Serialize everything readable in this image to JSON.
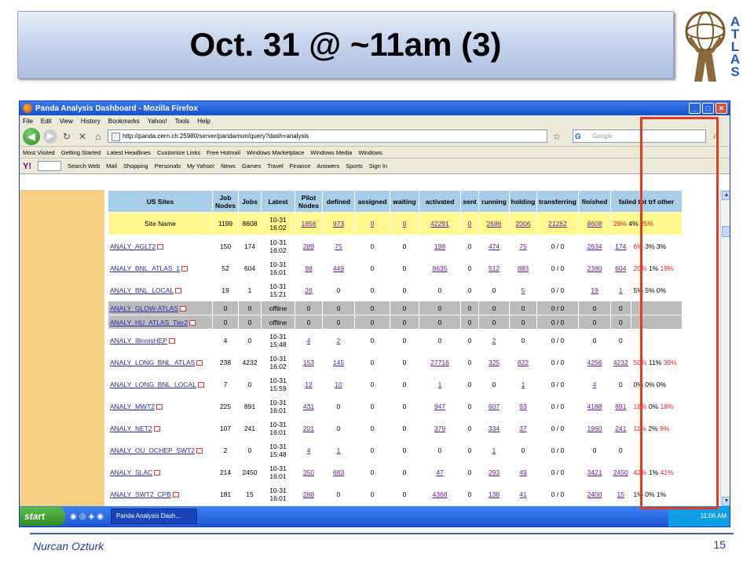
{
  "slide": {
    "title": "Oct. 31 @ ~11am (3)",
    "logo_letters": [
      "A",
      "T",
      "L",
      "A",
      "S"
    ],
    "footer_name": "Nurcan Ozturk",
    "page_number": "15"
  },
  "browser": {
    "window_title": "Panda Analysis Dashboard - Mozilla Firefox",
    "menu": [
      "File",
      "Edit",
      "View",
      "History",
      "Bookmarks",
      "Yahoo!",
      "Tools",
      "Help"
    ],
    "url": "http://panda.cern.ch:25980/server/pandamon/query?dash=analysis",
    "search_placeholder": "Google",
    "bookmarks": [
      "Most Visited",
      "Getting Started",
      "Latest Headlines",
      "Customize Links",
      "Free Hotmail",
      "Windows Marketplace",
      "Windows Media",
      "Windows"
    ],
    "yahoo_toolbar": [
      "Search Web",
      "Mail",
      "Shopping",
      "Personals",
      "My Yahoo!",
      "News",
      "Games",
      "Travel",
      "Finance",
      "Answers",
      "Sports",
      "Sign In"
    ]
  },
  "table": {
    "headers": [
      "US Sites",
      "Job Nodes",
      "Jobs",
      "Latest",
      "Pilot Nodes",
      "defined",
      "assigned",
      "waiting",
      "activated",
      "sent",
      "running",
      "holding",
      "transferring",
      "finished",
      "failed tot trf other"
    ],
    "site_row": {
      "name": "Site Name",
      "job_nodes": "1199",
      "jobs": "8608",
      "latest": "10-31 16:02",
      "pilot_nodes": "1856",
      "defined": "973",
      "assigned": "0",
      "waiting": "0",
      "activated": "42291",
      "sent": "0",
      "running": "2686",
      "holding": "2006",
      "transferring": "21262",
      "finished": "8608",
      "failed": "29%",
      "trf": "4%",
      "other": "25%"
    },
    "rows": [
      {
        "name": "ANALY_AGLT2",
        "job_nodes": "150",
        "jobs": "174",
        "latest": "10-31 16:02",
        "pilot_nodes": "289",
        "defined": "75",
        "assigned": "0",
        "waiting": "0",
        "activated": "198",
        "sent": "0",
        "running": "474",
        "holding": "75",
        "transferring": "0 / 0",
        "finished": "2634",
        "failed_tot": "174",
        "fail_pct": "6%",
        "trf_pct": "3%",
        "other_pct": "3%"
      },
      {
        "name": "ANALY_BNL_ATLAS_1",
        "job_nodes": "52",
        "jobs": "604",
        "latest": "10-31 16:01",
        "pilot_nodes": "98",
        "defined": "449",
        "assigned": "0",
        "waiting": "0",
        "activated": "8635",
        "sent": "0",
        "running": "512",
        "holding": "883",
        "transferring": "0 / 0",
        "finished": "2380",
        "failed_tot": "604",
        "fail_pct": "20%",
        "trf_pct": "1%",
        "other_pct": "19%"
      },
      {
        "name": "ANALY_BNL_LOCAL",
        "job_nodes": "19",
        "jobs": "1",
        "latest": "10-31 15:21",
        "pilot_nodes": "26",
        "defined": "0",
        "assigned": "0",
        "waiting": "0",
        "activated": "0",
        "sent": "0",
        "running": "0",
        "holding": "5",
        "transferring": "0 / 0",
        "finished": "19",
        "failed_tot": "1",
        "fail_pct": "5%",
        "trf_pct": "5%",
        "other_pct": "0%"
      },
      {
        "name": "ANALY_GLOW-ATLAS",
        "job_nodes": "0",
        "jobs": "0",
        "latest": "offline",
        "pilot_nodes": "0",
        "defined": "0",
        "assigned": "0",
        "waiting": "0",
        "activated": "0",
        "sent": "0",
        "running": "0",
        "holding": "0",
        "transferring": "0 / 0",
        "finished": "0",
        "failed_tot": "0",
        "fail_pct": "",
        "trf_pct": "",
        "other_pct": ""
      },
      {
        "name": "ANALY_HU_ATLAS_Tier2",
        "job_nodes": "0",
        "jobs": "0",
        "latest": "offline",
        "pilot_nodes": "0",
        "defined": "0",
        "assigned": "0",
        "waiting": "0",
        "activated": "0",
        "sent": "0",
        "running": "0",
        "holding": "0",
        "transferring": "0 / 0",
        "finished": "0",
        "failed_tot": "0",
        "fail_pct": "",
        "trf_pct": "",
        "other_pct": ""
      },
      {
        "name": "ANALY_IllinoisHEP",
        "job_nodes": "4",
        "jobs": "0",
        "latest": "10-31 15:48",
        "pilot_nodes": "4",
        "defined": "2",
        "assigned": "0",
        "waiting": "0",
        "activated": "0",
        "sent": "0",
        "running": "2",
        "holding": "0",
        "transferring": "0 / 0",
        "finished": "0",
        "failed_tot": "0",
        "fail_pct": "",
        "trf_pct": "",
        "other_pct": ""
      },
      {
        "name": "ANALY_LONG_BNL_ATLAS",
        "job_nodes": "238",
        "jobs": "4232",
        "latest": "10-31 16:02",
        "pilot_nodes": "153",
        "defined": "145",
        "assigned": "0",
        "waiting": "0",
        "activated": "27716",
        "sent": "0",
        "running": "325",
        "holding": "822",
        "transferring": "0 / 0",
        "finished": "4256",
        "failed_tot": "4232",
        "fail_pct": "50%",
        "trf_pct": "11%",
        "other_pct": "39%"
      },
      {
        "name": "ANALY_LONG_BNL_LOCAL",
        "job_nodes": "7",
        "jobs": "0",
        "latest": "10-31 15:59",
        "pilot_nodes": "12",
        "defined": "10",
        "assigned": "0",
        "waiting": "0",
        "activated": "1",
        "sent": "0",
        "running": "0",
        "holding": "1",
        "transferring": "0 / 0",
        "finished": "4",
        "failed_tot": "0",
        "fail_pct": "0%",
        "trf_pct": "0%",
        "other_pct": "0%"
      },
      {
        "name": "ANALY_MWT2",
        "job_nodes": "225",
        "jobs": "891",
        "latest": "10-31 16:01",
        "pilot_nodes": "431",
        "defined": "0",
        "assigned": "0",
        "waiting": "0",
        "activated": "947",
        "sent": "0",
        "running": "607",
        "holding": "93",
        "transferring": "0 / 0",
        "finished": "4188",
        "failed_tot": "891",
        "fail_pct": "18%",
        "trf_pct": "0%",
        "other_pct": "18%"
      },
      {
        "name": "ANALY_NET2",
        "job_nodes": "107",
        "jobs": "241",
        "latest": "10-31 16:01",
        "pilot_nodes": "201",
        "defined": "0",
        "assigned": "0",
        "waiting": "0",
        "activated": "379",
        "sent": "0",
        "running": "334",
        "holding": "37",
        "transferring": "0 / 0",
        "finished": "1960",
        "failed_tot": "241",
        "fail_pct": "11%",
        "trf_pct": "2%",
        "other_pct": "9%"
      },
      {
        "name": "ANALY_OU_OCHEP_SWT2",
        "job_nodes": "2",
        "jobs": "0",
        "latest": "10-31 15:48",
        "pilot_nodes": "4",
        "defined": "1",
        "assigned": "0",
        "waiting": "0",
        "activated": "0",
        "sent": "0",
        "running": "1",
        "holding": "0",
        "transferring": "0 / 0",
        "finished": "0",
        "failed_tot": "0",
        "fail_pct": "",
        "trf_pct": "",
        "other_pct": ""
      },
      {
        "name": "ANALY_SLAC",
        "job_nodes": "214",
        "jobs": "2450",
        "latest": "10-31 16:01",
        "pilot_nodes": "350",
        "defined": "683",
        "assigned": "0",
        "waiting": "0",
        "activated": "47",
        "sent": "0",
        "running": "293",
        "holding": "49",
        "transferring": "0 / 0",
        "finished": "3421",
        "failed_tot": "2450",
        "fail_pct": "42%",
        "trf_pct": "1%",
        "other_pct": "41%"
      },
      {
        "name": "ANALY_SWT2_CPB",
        "job_nodes": "181",
        "jobs": "15",
        "latest": "10-31 16:01",
        "pilot_nodes": "288",
        "defined": "0",
        "assigned": "0",
        "waiting": "0",
        "activated": "4368",
        "sent": "0",
        "running": "138",
        "holding": "41",
        "transferring": "0 / 0",
        "finished": "2400",
        "failed_tot": "15",
        "fail_pct": "1%",
        "trf_pct": "0%",
        "other_pct": "1%"
      }
    ]
  },
  "taskbar": {
    "start_label": "start",
    "task": "Panda Analysis Dash...",
    "clock": "11:06 AM"
  },
  "colors": {
    "highlight_box": "#e53b22",
    "header_bg": "#a8cde8",
    "site_row_bg": "#fff990",
    "left_strip": "#f7cf84"
  }
}
